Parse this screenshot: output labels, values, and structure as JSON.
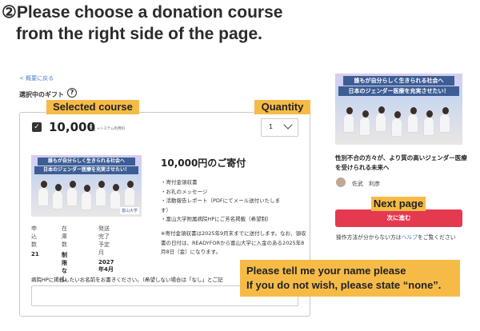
{
  "heading": {
    "line1": "②Please choose a donation course",
    "line2": "from the right side of the page."
  },
  "nav": {
    "back": "< 概要に戻る"
  },
  "gift_section": {
    "label": "選択中のギフト",
    "help_icon": "?"
  },
  "callouts": {
    "course": "Selected course",
    "quantity": "Quantity",
    "next_page": "Next page",
    "name_line1": "Please tell me your name please",
    "name_line2": "If you do not wish, please state “none”."
  },
  "course": {
    "amount": "10,000",
    "unit": "円",
    "fee_note": "+システム利用料",
    "quantity": "1",
    "thumb_banner1": "誰もが自分らしく生きられる社会へ",
    "thumb_banner2": "日本のジェンダー医療を充実させたい！",
    "univ_tag": "富山大学",
    "detail_title": "10,000円のご寄付",
    "bullets": [
      "・寄付金領収書",
      "・お礼のメッセージ",
      "・活動報告レポート（PDFにてメール送付いたしま",
      "す）",
      "・富山大学附属病院HPにご芳名掲載（希望制）"
    ],
    "note": "※寄付金領収書は2025年9月末までに送付します。なお、領収書の日付は、READYFORから富山大学に入金のある2025年8月8日（金）になります。",
    "stats": [
      {
        "label": "申込数",
        "value": "21"
      },
      {
        "label": "在庫数",
        "value": "制限なし"
      },
      {
        "label": "発送完了予定月",
        "value": "2027年4月"
      }
    ],
    "name_prompt": "病院HPに掲載したいお名前をお書きください。（希望しない場合は「なし」とご記",
    "name_value": ""
  },
  "sidebar": {
    "photo_banner1": "誰もが自分らしく生きられる社会へ",
    "photo_banner2": "日本のジェンダー医療を充実させたい！",
    "project_title": "性別不合の方々が、より質の高いジェンダー医療を受けられる未来へ",
    "author": "佐武　利彦",
    "next_button": "次に進む",
    "help_prefix": "操作方法が分からない方は",
    "help_link": "ヘルプ",
    "help_suffix": "をご覧ください"
  },
  "colors": {
    "callout": "#f6bb47",
    "next_button": "#e53950",
    "banner": "#3d5e94",
    "link": "#4a7fd0"
  },
  "icons": {
    "help": "question-circle-icon",
    "checkbox": "checkbox-checked-icon",
    "chevron": "chevron-down-icon"
  }
}
